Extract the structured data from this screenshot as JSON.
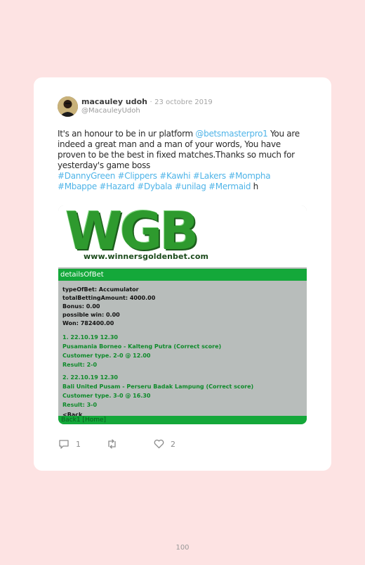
{
  "tweet": {
    "author_name": "macauley udoh",
    "separator": "·",
    "date": "23 octobre 2019",
    "handle": "@MacauleyUdoh",
    "text_part1": "It's an honour to be in ur platform ",
    "mention": "@betsmasterpro1",
    "text_part2": " You are indeed a great man and a man of your words, You have proven to be the best in fixed matches.Thanks so much for yesterday's game boss",
    "hashtags": "#DannyGreen #Clippers #Kawhi #Lakers #Mompha #Mbappe #Hazard #Dybala #unilag #Mermaid",
    "trailing": " h"
  },
  "screenshot": {
    "logo": "WGB",
    "url": "www.winnersgoldenbet.com",
    "header": "detailsOfBet",
    "lines": [
      "typeOfBet: Accumulator",
      "totalBettingAmount:  4000.00",
      "Bonus: 0.00",
      "possible win: 0.00",
      "Won: 782400.00",
      "1.  22.10.19  12.30",
      "Pusamania Borneo  - Kalteng Putra (Correct score)",
      "Customer type. 2-0 @ 12.00",
      "Result: 2-0",
      "2.  22.10.19  12.30",
      "Bali United Pusam -  Perseru Badak Lampung (Correct score)",
      "Customer type. 3-0 @ 16.30",
      "Result: 3-0",
      "<Back"
    ],
    "footer": "Back1 [Home]"
  },
  "actions": {
    "replies": "1",
    "likes": "2"
  },
  "page_number": "100",
  "colors": {
    "background": "#fde3e3",
    "link": "#4fb4e8",
    "green": "#14a83a"
  }
}
